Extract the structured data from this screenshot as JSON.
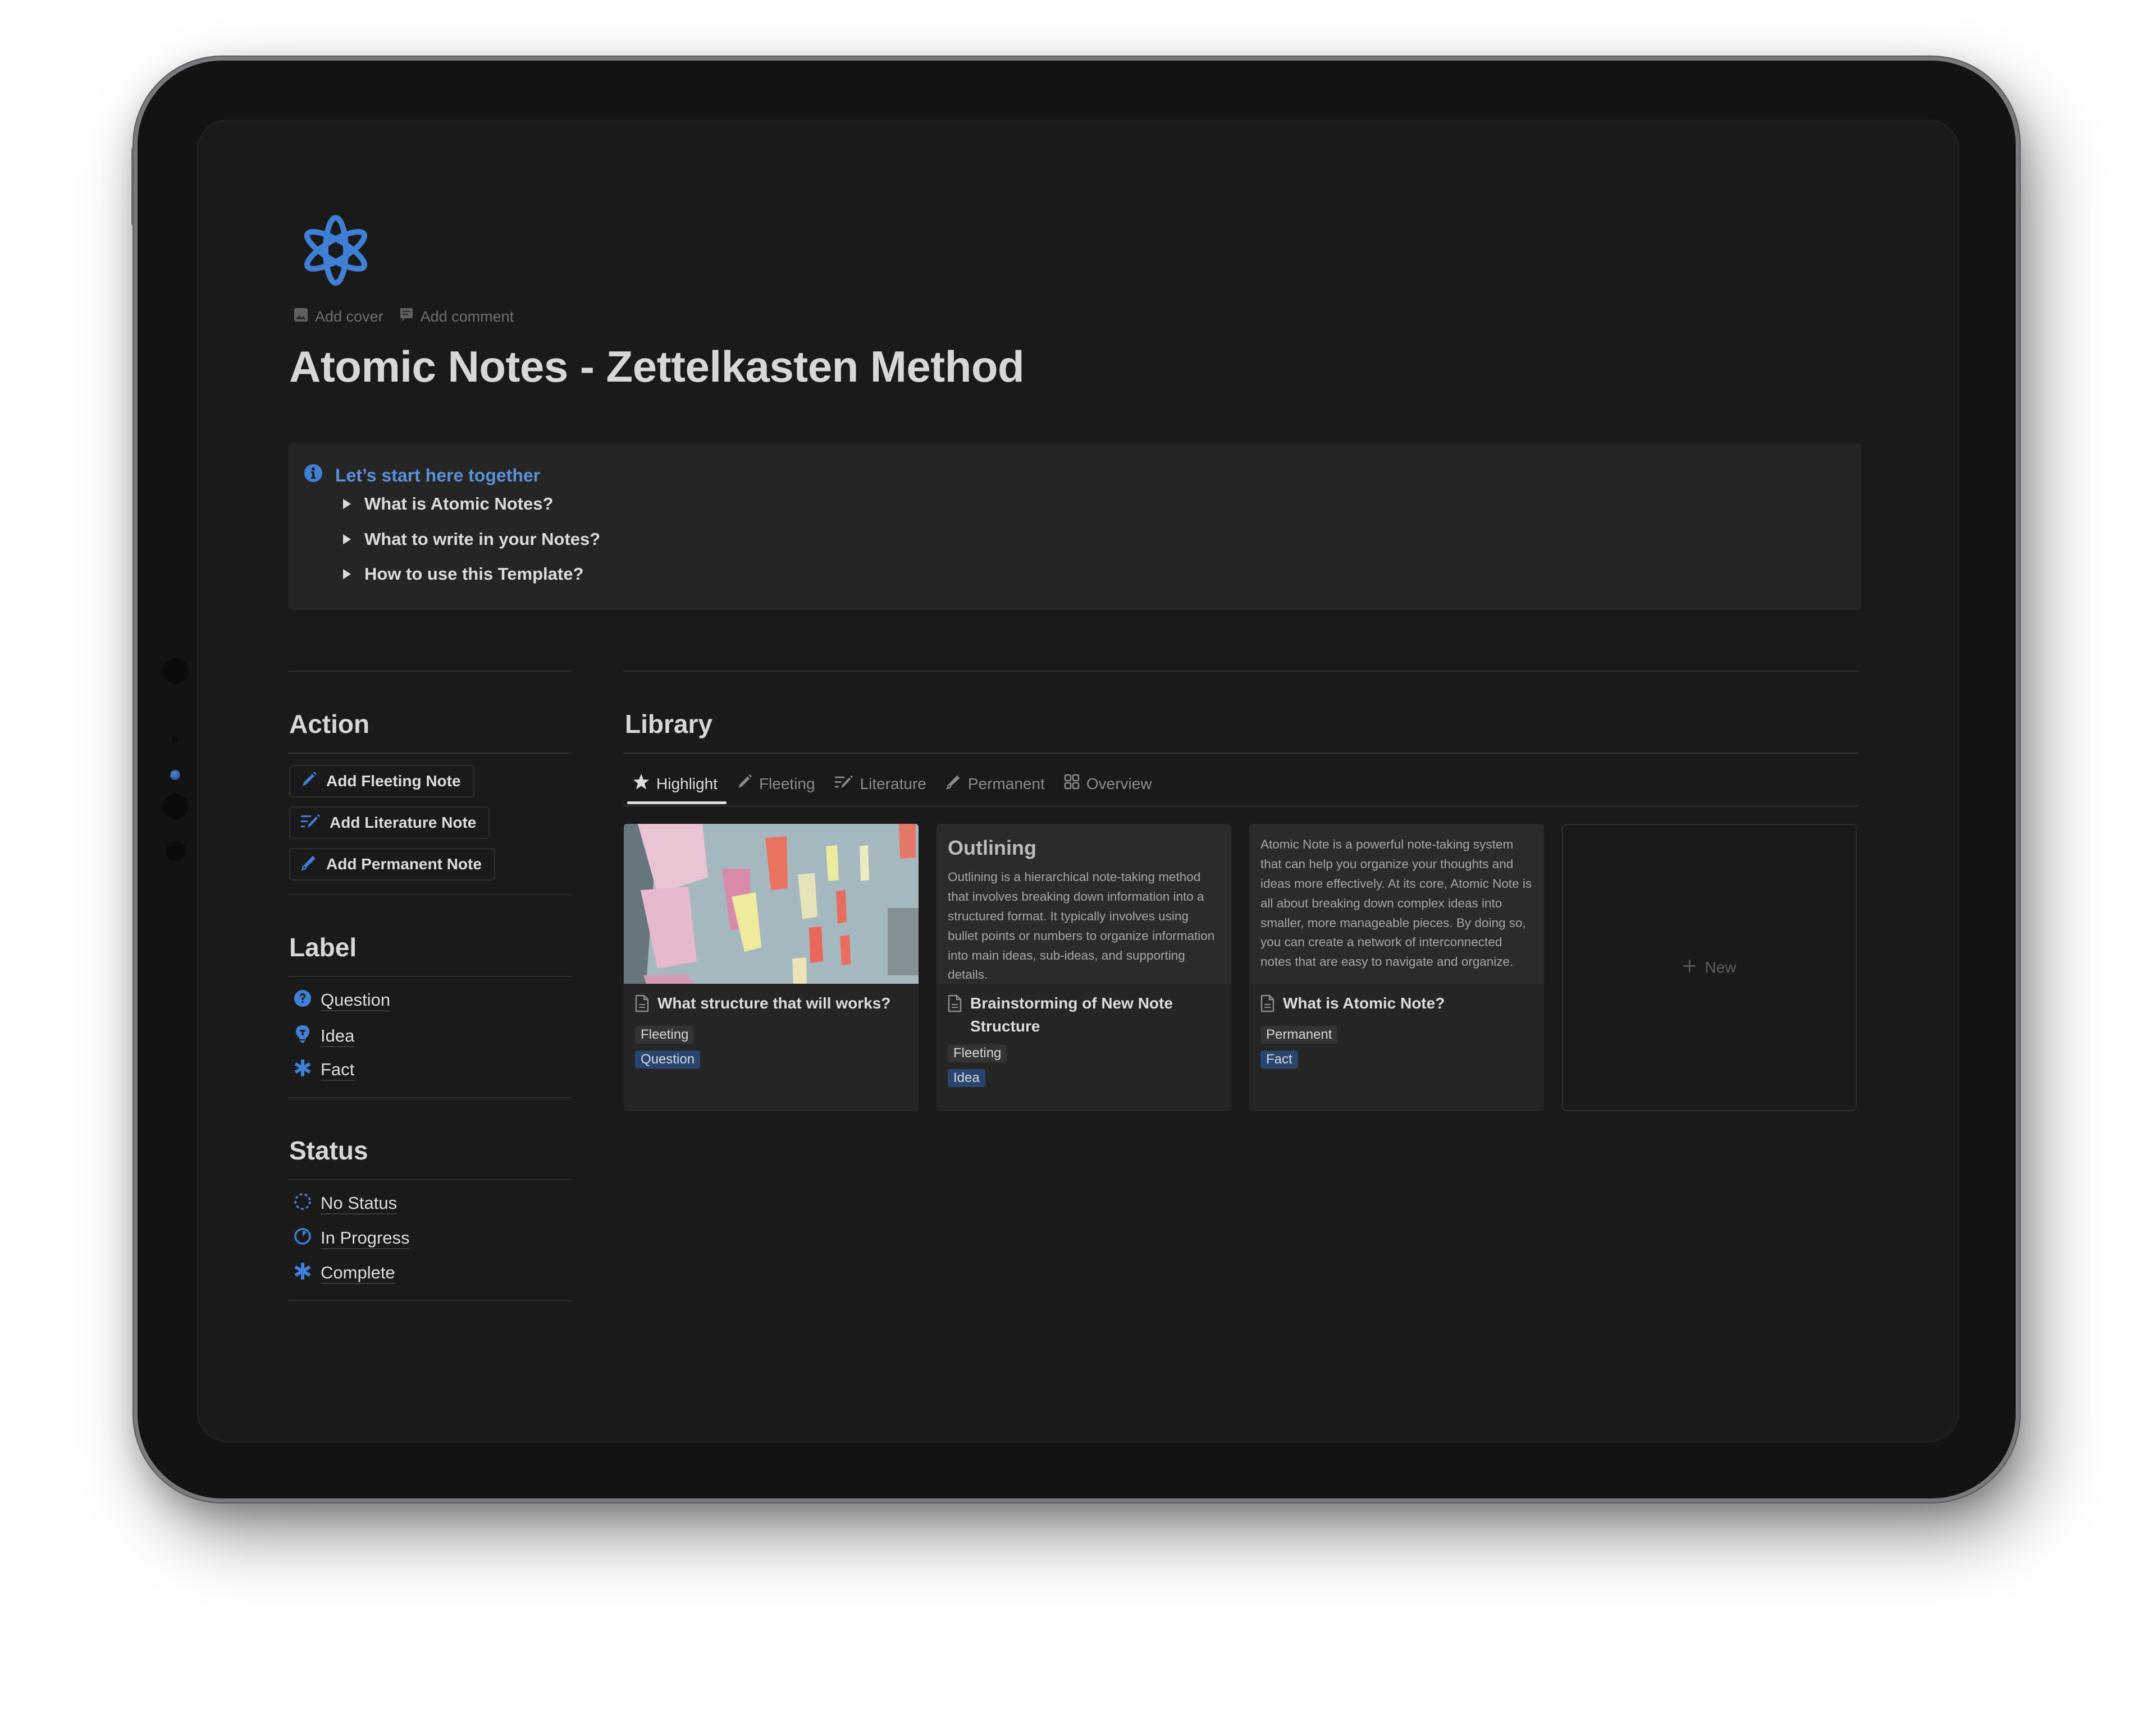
{
  "page": {
    "title": "Atomic Notes - Zettelkasten Method",
    "icon": "atom-icon",
    "meta_actions": [
      {
        "label": "Add cover",
        "icon": "image-icon"
      },
      {
        "label": "Add comment",
        "icon": "comment-icon"
      }
    ]
  },
  "callout": {
    "icon": "info-icon",
    "heading": "Let’s start here together",
    "toggles": [
      {
        "label": "What is Atomic Notes?"
      },
      {
        "label": "What to write in your Notes?"
      },
      {
        "label": "How to use this Template?"
      }
    ]
  },
  "action": {
    "heading": "Action",
    "buttons": [
      {
        "label": "Add Fleeting Note",
        "icon": "pencil-icon"
      },
      {
        "label": "Add Literature Note",
        "icon": "text-edit-icon"
      },
      {
        "label": "Add Permanent Note",
        "icon": "fountain-pen-icon"
      }
    ]
  },
  "label": {
    "heading": "Label",
    "items": [
      {
        "label": "Question",
        "icon": "question-circle-icon"
      },
      {
        "label": "Idea",
        "icon": "lightbulb-icon"
      },
      {
        "label": "Fact",
        "icon": "asterisk-icon"
      }
    ]
  },
  "status": {
    "heading": "Status",
    "items": [
      {
        "label": "No Status",
        "icon": "dashed-circle-icon"
      },
      {
        "label": "In Progress",
        "icon": "progress-circle-icon"
      },
      {
        "label": "Complete",
        "icon": "asterisk-icon"
      }
    ]
  },
  "library": {
    "heading": "Library",
    "tabs": [
      {
        "label": "Highlight",
        "icon": "star-icon",
        "active": true
      },
      {
        "label": "Fleeting",
        "icon": "pencil-icon",
        "active": false
      },
      {
        "label": "Literature",
        "icon": "text-edit-icon",
        "active": false
      },
      {
        "label": "Permanent",
        "icon": "fountain-pen-icon",
        "active": false
      },
      {
        "label": "Overview",
        "icon": "grid-icon",
        "active": false
      }
    ],
    "cards": [
      {
        "preview_type": "image",
        "preview_alt": "sticky notes on wall",
        "title": "What structure that will works?",
        "tags": [
          {
            "label": "Fleeting",
            "style": "gray"
          },
          {
            "label": "Question",
            "style": "blue"
          }
        ]
      },
      {
        "preview_type": "text",
        "preview_heading": "Outlining",
        "preview_text": "Outlining is a hierarchical note-taking method that involves breaking down information into a structured format. It typically involves using bullet points or numbers to organize information into main ideas, sub-ideas, and supporting details.",
        "title": "Brainstorming of New Note Structure",
        "tags": [
          {
            "label": "Fleeting",
            "style": "gray"
          },
          {
            "label": "Idea",
            "style": "blue"
          }
        ]
      },
      {
        "preview_type": "text",
        "preview_text": "Atomic Note is a powerful note-taking system that can help you organize your thoughts and ideas more effectively. At its core, Atomic Note is all about breaking down complex ideas into smaller, more manageable pieces. By doing so, you can create a network of interconnected notes that are easy to navigate and organize.",
        "title": "What is Atomic Note?",
        "tags": [
          {
            "label": "Permanent",
            "style": "gray"
          },
          {
            "label": "Fact",
            "style": "blue"
          }
        ]
      }
    ],
    "new_label": "New"
  },
  "colors": {
    "accent": "#3f7fd6",
    "background": "#1a1a1a",
    "callout_bg": "#252525",
    "text": "#dcdcdc",
    "tag_blue": "#28456f",
    "tag_gray": "#333333"
  }
}
